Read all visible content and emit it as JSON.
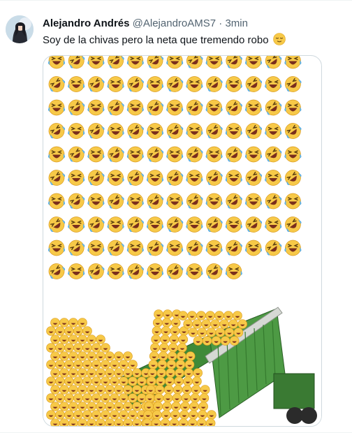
{
  "tweet": {
    "author_name": "Alejandro Andrés",
    "author_handle": "@AlejandroAMS7",
    "separator": "·",
    "time": "3min",
    "text": "Soy de la chivas pero la neta que tremendo robo",
    "text_emoji_icon": "relieved-face-icon"
  },
  "media": {
    "image_icon": "laughing-emoji-grid-dump-truck-meme",
    "emoji_icons": [
      "tears-of-joy-emoji-icon",
      "rolling-on-floor-laughing-emoji-icon"
    ],
    "truck_color": "#3f8a38",
    "emoji_color": "#f7c948"
  }
}
